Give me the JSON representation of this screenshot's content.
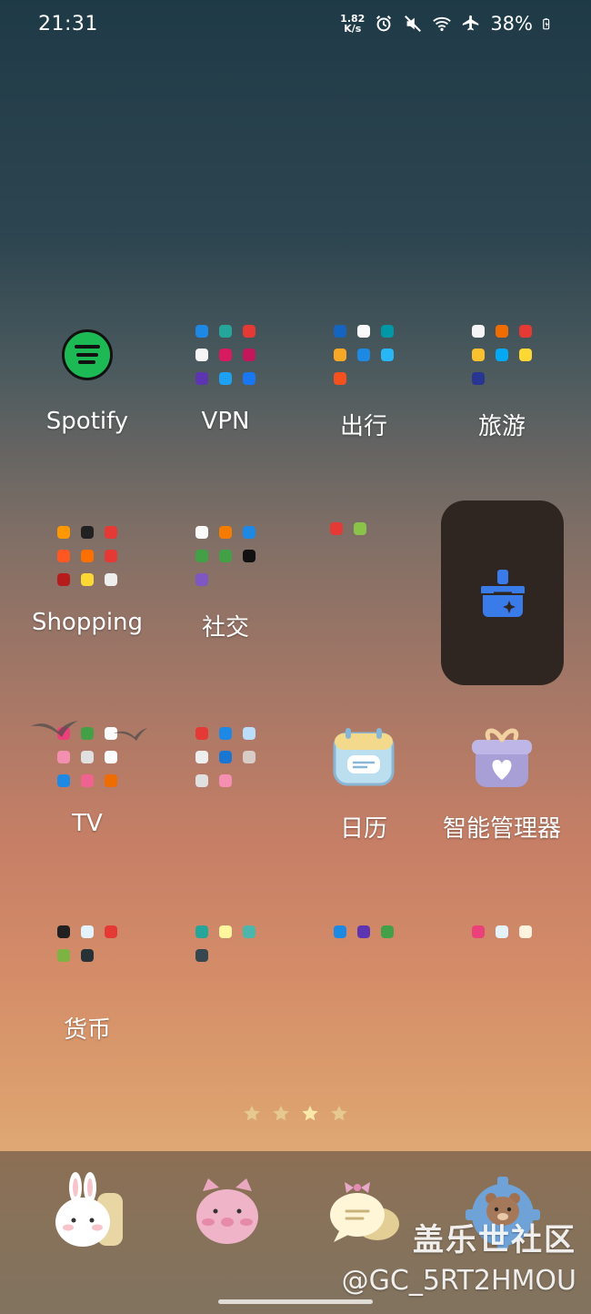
{
  "status": {
    "time": "21:31",
    "net_speed_top": "1.82",
    "net_speed_bottom": "K/s",
    "battery": "38%"
  },
  "apps": [
    {
      "label": "Spotify"
    },
    {
      "label": "VPN"
    },
    {
      "label": "出行"
    },
    {
      "label": "旅游"
    },
    {
      "label": "Shopping"
    },
    {
      "label": "社交"
    },
    {
      "label": ""
    },
    {
      "label": ""
    },
    {
      "label": "TV"
    },
    {
      "label": ""
    },
    {
      "label": "日历"
    },
    {
      "label": "智能管理器"
    },
    {
      "label": "货币"
    },
    {
      "label": ""
    },
    {
      "label": ""
    },
    {
      "label": ""
    }
  ],
  "watermark": {
    "line1": "盖乐世社区",
    "line2": "@GC_5RT2HMOU"
  },
  "colors": {
    "spotify_green": "#1db954",
    "cleaner_blue": "#3a7bea",
    "widget_bg": "#2f2622"
  }
}
